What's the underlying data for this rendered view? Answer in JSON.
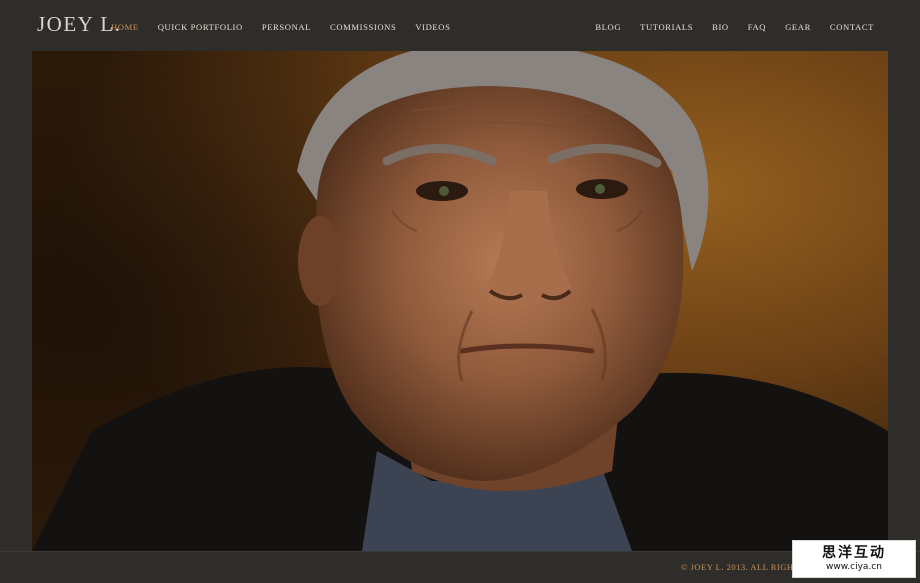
{
  "header": {
    "logo": "JOEY L.",
    "nav_left": [
      {
        "label": "HOME",
        "active": true
      },
      {
        "label": "QUICK PORTFOLIO",
        "active": false
      },
      {
        "label": "PERSONAL",
        "active": false
      },
      {
        "label": "COMMISSIONS",
        "active": false
      },
      {
        "label": "VIDEOS",
        "active": false
      }
    ],
    "nav_right": [
      {
        "label": "BLOG"
      },
      {
        "label": "TUTORIALS"
      },
      {
        "label": "BIO"
      },
      {
        "label": "FAQ"
      },
      {
        "label": "GEAR"
      },
      {
        "label": "CONTACT"
      }
    ]
  },
  "footer": {
    "copyright": "© JOEY L. 2013. ALL RIGHTS"
  },
  "watermark": {
    "name_cn": "思洋互动",
    "url": "www.ciya.cn"
  },
  "colors": {
    "background": "#2f2d2a",
    "text": "#e6e1d7",
    "accent": "#c9935a"
  }
}
